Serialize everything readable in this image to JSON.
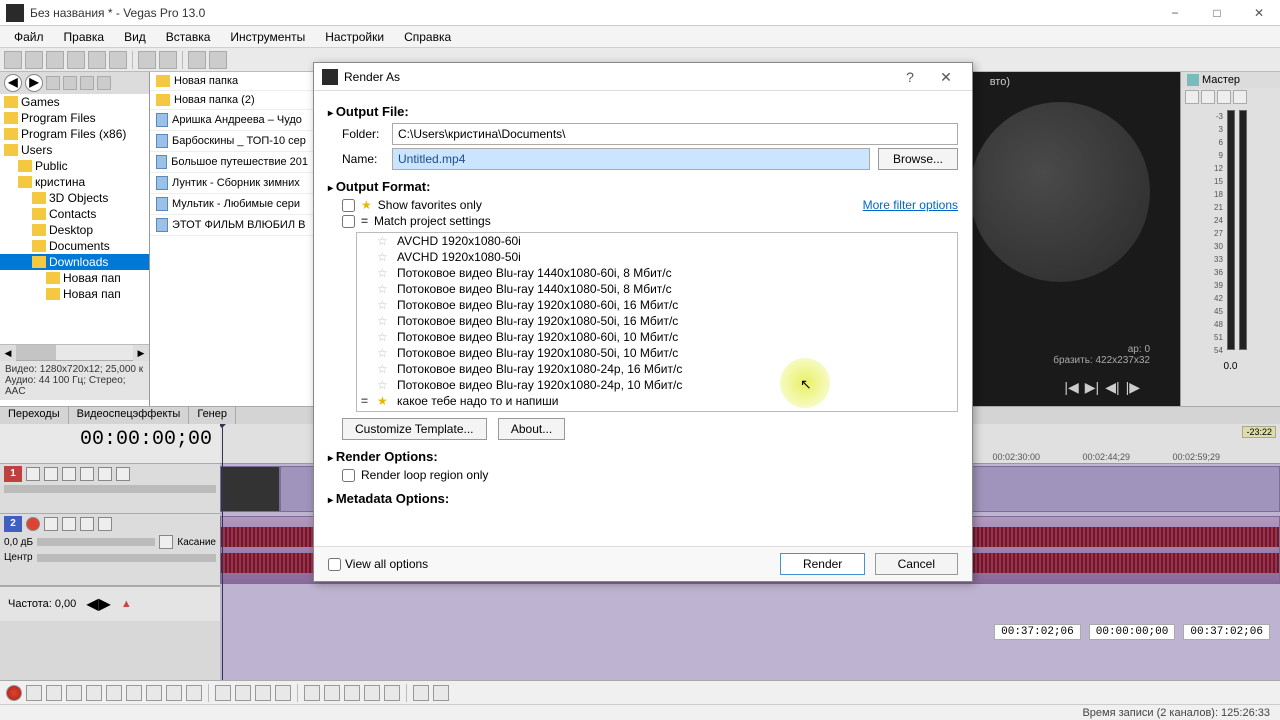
{
  "titlebar": {
    "app_icon": "vegas-icon",
    "title": "Без названия * - Vegas Pro 13.0"
  },
  "menubar": [
    "Файл",
    "Правка",
    "Вид",
    "Вставка",
    "Инструменты",
    "Настройки",
    "Справка"
  ],
  "explorer": {
    "tree": [
      {
        "label": "Games",
        "indent": 0
      },
      {
        "label": "Program Files",
        "indent": 0
      },
      {
        "label": "Program Files (x86)",
        "indent": 0
      },
      {
        "label": "Users",
        "indent": 0
      },
      {
        "label": "Public",
        "indent": 1
      },
      {
        "label": "кристина",
        "indent": 1
      },
      {
        "label": "3D Objects",
        "indent": 2
      },
      {
        "label": "Contacts",
        "indent": 2
      },
      {
        "label": "Desktop",
        "indent": 2
      },
      {
        "label": "Documents",
        "indent": 2
      },
      {
        "label": "Downloads",
        "indent": 2,
        "selected": true
      },
      {
        "label": "Новая пап",
        "indent": 3
      },
      {
        "label": "Новая пап",
        "indent": 3
      }
    ],
    "meta1": "Видео: 1280x720x12; 25,000 к",
    "meta2": "Аудио: 44 100 Гц; Стерео; AAC"
  },
  "filelist": [
    {
      "label": "Новая папка",
      "type": "folder"
    },
    {
      "label": "Новая папка (2)",
      "type": "folder"
    },
    {
      "label": "Аришка Андреева – Чудо",
      "type": "file"
    },
    {
      "label": "Барбоскины _ ТОП-10 сер",
      "type": "file"
    },
    {
      "label": "Большое путешествие 201",
      "type": "file"
    },
    {
      "label": "Лунтик - Сборник зимних",
      "type": "file"
    },
    {
      "label": "Мультик - Любимые сери",
      "type": "file"
    },
    {
      "label": "ЭТОТ ФИЛЬМ ВЛЮБИЛ В",
      "type": "file"
    }
  ],
  "tabs": [
    "Переходы",
    "Видеоспецэффекты",
    "Генер"
  ],
  "timeline": {
    "tc": "00:00:00;00",
    "track1_num": "1",
    "track2_num": "2",
    "track2_db": "0,0 дБ",
    "track2_pan": "Касание",
    "track2_center": "Центр",
    "times": [
      "00:02:30:00",
      "00:02:44;29",
      "00:02:59;29"
    ],
    "marker": "-23:22"
  },
  "freq": {
    "label": "Частота: 0,00"
  },
  "time_right": {
    "a": "00:37:02;06",
    "b": "00:00:00;00",
    "c": "00:37:02;06"
  },
  "preview": {
    "line1": "ар:",
    "val1": "0",
    "line2": "бразить:",
    "val2": "422x237x32",
    "auto": "вто)"
  },
  "mixer": {
    "title": "Мастер",
    "val": "0.0",
    "ticks": [
      "-3",
      "3",
      "6",
      "9",
      "12",
      "15",
      "18",
      "21",
      "24",
      "27",
      "30",
      "33",
      "36",
      "39",
      "42",
      "45",
      "48",
      "51",
      "54"
    ]
  },
  "status": "Время записи (2 каналов): 125:26:33",
  "dialog": {
    "title": "Render As",
    "help": "?",
    "close": "✕",
    "sec_output_file": "Output File:",
    "folder_label": "Folder:",
    "folder_value": "C:\\Users\\кристина\\Documents\\",
    "name_label": "Name:",
    "name_value": "Untitled.mp4",
    "browse": "Browse...",
    "sec_output_format": "Output Format:",
    "show_fav": "Show favorites only",
    "match_proj": "Match project settings",
    "more_filter": "More filter options",
    "formats": [
      {
        "label": "AVCHD 1920x1080-60i"
      },
      {
        "label": "AVCHD 1920x1080-50i"
      },
      {
        "label": "Потоковое видео Blu-ray 1440x1080-60i, 8 Мбит/с"
      },
      {
        "label": "Потоковое видео Blu-ray 1440x1080-50i, 8 Мбит/с"
      },
      {
        "label": "Потоковое видео Blu-ray 1920x1080-60i, 16 Мбит/с"
      },
      {
        "label": "Потоковое видео Blu-ray 1920x1080-50i, 16 Мбит/с"
      },
      {
        "label": "Потоковое видео Blu-ray 1920x1080-60i, 10 Мбит/с"
      },
      {
        "label": "Потоковое видео Blu-ray 1920x1080-50i, 10 Мбит/с"
      },
      {
        "label": "Потоковое видео Blu-ray 1920x1080-24p, 16 Мбит/с"
      },
      {
        "label": "Потоковое видео Blu-ray 1920x1080-24p, 10 Мбит/с"
      },
      {
        "label": "какое тебе надо то и напиши",
        "fav": true,
        "match": true
      }
    ],
    "customize": "Customize Template...",
    "about": "About...",
    "sec_render_opts": "Render Options:",
    "render_loop": "Render loop region only",
    "sec_meta": "Metadata Options:",
    "view_all": "View all options",
    "render": "Render",
    "cancel": "Cancel"
  }
}
